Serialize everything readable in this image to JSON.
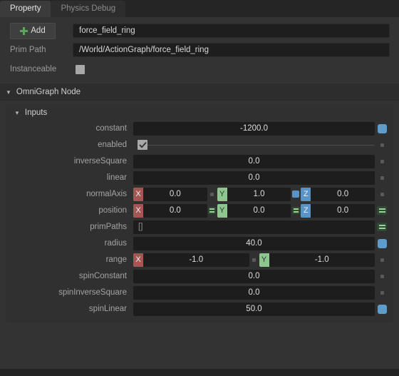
{
  "tabs": [
    {
      "label": "Property",
      "active": true
    },
    {
      "label": "Physics Debug",
      "active": false
    }
  ],
  "header": {
    "add_label": "Add",
    "add_icon": "plus-icon",
    "name_value": "force_field_ring",
    "prim_path_label": "Prim Path",
    "prim_path_value": "/World/ActionGraph/force_field_ring",
    "instanceable_label": "Instanceable",
    "instanceable_checked": false
  },
  "section": {
    "title": "OmniGraph Node",
    "subsection_title": "Inputs"
  },
  "properties": [
    {
      "label": "constant",
      "kind": "scalar",
      "value": "-1200.0",
      "indicator": "blue-square"
    },
    {
      "label": "enabled",
      "kind": "checkbox",
      "checked": true,
      "indicator": "grey-dot"
    },
    {
      "label": "inverseSquare",
      "kind": "scalar",
      "value": "0.0",
      "indicator": "grey-dot"
    },
    {
      "label": "linear",
      "kind": "scalar",
      "value": "0.0",
      "indicator": "grey-dot"
    },
    {
      "label": "normalAxis",
      "kind": "vector",
      "components": [
        {
          "axis": "X",
          "value": "0.0",
          "separator": "none"
        },
        {
          "axis": "Y",
          "value": "1.0",
          "separator": "grey-dot"
        },
        {
          "axis": "Z",
          "value": "0.0",
          "separator": "blue-square"
        }
      ],
      "indicator": "grey-dot"
    },
    {
      "label": "position",
      "kind": "vector",
      "components": [
        {
          "axis": "X",
          "value": "0.0",
          "separator": "none"
        },
        {
          "axis": "Y",
          "value": "0.0",
          "separator": "green-equals"
        },
        {
          "axis": "Z",
          "value": "0.0",
          "separator": "green-equals"
        }
      ],
      "indicator": "green-equals"
    },
    {
      "label": "primPaths",
      "kind": "text",
      "value": "[]",
      "indicator": "green-equals"
    },
    {
      "label": "radius",
      "kind": "scalar",
      "value": "40.0",
      "indicator": "blue-square"
    },
    {
      "label": "range",
      "kind": "vector",
      "components": [
        {
          "axis": "X",
          "value": "-1.0",
          "separator": "none"
        },
        {
          "axis": "Y",
          "value": "-1.0",
          "separator": "grey-dot"
        }
      ],
      "indicator": "grey-dot"
    },
    {
      "label": "spinConstant",
      "kind": "scalar",
      "value": "0.0",
      "indicator": "grey-dot"
    },
    {
      "label": "spinInverseSquare",
      "kind": "scalar",
      "value": "0.0",
      "indicator": "grey-dot"
    },
    {
      "label": "spinLinear",
      "kind": "scalar",
      "value": "50.0",
      "indicator": "blue-square"
    }
  ],
  "colors": {
    "axis_x": "#a75454",
    "axis_y": "#8fc68f",
    "axis_z": "#5b94c4",
    "accent_blue": "#5e9ccc",
    "accent_green": "#9ccf9c",
    "panel_bg": "#333333",
    "field_bg": "#1d1d1d"
  }
}
